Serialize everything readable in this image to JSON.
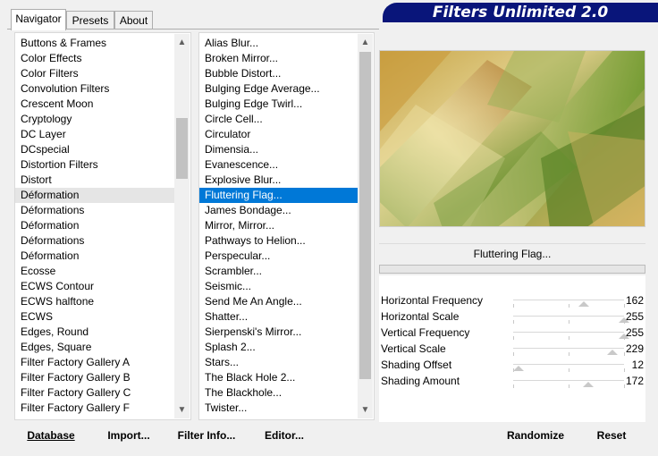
{
  "tabs": [
    {
      "label": "Navigator"
    },
    {
      "label": "Presets"
    },
    {
      "label": "About"
    }
  ],
  "banner": {
    "title": "Filters Unlimited 2.0"
  },
  "categories": [
    "Buttons & Frames",
    "Color Effects",
    "Color Filters",
    "Convolution Filters",
    "Crescent Moon",
    "Cryptology",
    "DC Layer",
    "DCspecial",
    "Distortion Filters",
    "Distort",
    "Déformation",
    "Déformations",
    "Déformation",
    "Déformations",
    "Déformation",
    "Ecosse",
    "ECWS Contour",
    "ECWS halftone",
    "ECWS",
    "Edges, Round",
    "Edges, Square",
    "Filter Factory Gallery A",
    "Filter Factory Gallery B",
    "Filter Factory Gallery C",
    "Filter Factory Gallery F"
  ],
  "selected_category": "Déformation",
  "filters": [
    "Alias Blur...",
    "Broken Mirror...",
    "Bubble Distort...",
    "Bulging Edge Average...",
    "Bulging Edge Twirl...",
    "Circle Cell...",
    "Circulator",
    "Dimensia...",
    "Evanescence...",
    "Explosive Blur...",
    "Fluttering Flag...",
    "James Bondage...",
    "Mirror, Mirror...",
    "Pathways to Helion...",
    "Perspecular...",
    "Scrambler...",
    "Seismic...",
    "Send Me An Angle...",
    "Shatter...",
    "Sierpenski's Mirror...",
    "Splash 2...",
    "Stars...",
    "The Black Hole 2...",
    "The Blackhole...",
    "Twister..."
  ],
  "selected_filter": "Fluttering Flag...",
  "current_filter": {
    "name": "Fluttering Flag..."
  },
  "parameters": [
    {
      "label": "Horizontal Frequency",
      "value": "162",
      "level": 0.635
    },
    {
      "label": "Horizontal Scale",
      "value": "255",
      "level": 1.0
    },
    {
      "label": "Vertical Frequency",
      "value": "255",
      "level": 1.0
    },
    {
      "label": "Vertical Scale",
      "value": "229",
      "level": 0.898
    },
    {
      "label": "Shading Offset",
      "value": "12",
      "level": 0.047
    },
    {
      "label": "Shading Amount",
      "value": "172",
      "level": 0.675
    }
  ],
  "buttons": {
    "database": "Database",
    "import": "Import...",
    "filter_info": "Filter Info...",
    "editor": "Editor...",
    "randomize": "Randomize",
    "reset": "Reset"
  },
  "colors": {
    "banner": "#09157a",
    "selection": "#0078d7",
    "preview_gold": "#d7b867",
    "preview_green": "#6e8f2a"
  }
}
